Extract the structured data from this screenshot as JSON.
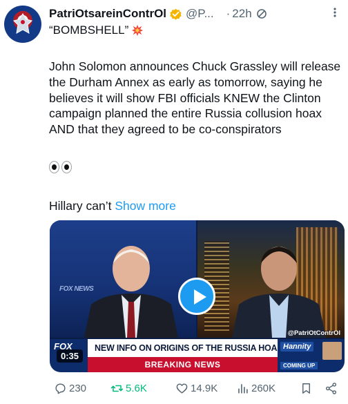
{
  "author": {
    "display_name": "PatriOtsareinContrOl",
    "handle": "@P...",
    "separator": "·",
    "time": "22h"
  },
  "subtitle": "“BOMBSHELL”",
  "body_text": "John Solomon announces Chuck Grassley will release the Durham Annex as early as tomorrow, saying he believes it will show FBI officials KNEW the Clinton campaign planned the entire Russia collusion hoax AND that they agreed to be co-conspirators",
  "tail_text": "Hillary can’t",
  "show_more": "Show more",
  "media": {
    "duration": "0:35",
    "watermark": "@PatriOtContrOl",
    "chyron_headline": "NEW INFO ON ORIGINS OF THE RUSSIA HOAX REVEALED",
    "chyron_breaking": "BREAKING NEWS",
    "chyron_show": "Hannity",
    "chyron_coming": "COMING UP"
  },
  "actions": {
    "replies": "230",
    "reposts": "5.6K",
    "likes": "14.9K",
    "views": "260K"
  },
  "colors": {
    "accent": "#1d9bf0",
    "repost_green": "#00ba7c",
    "muted": "#536471",
    "breaking_red": "#c8102e"
  }
}
